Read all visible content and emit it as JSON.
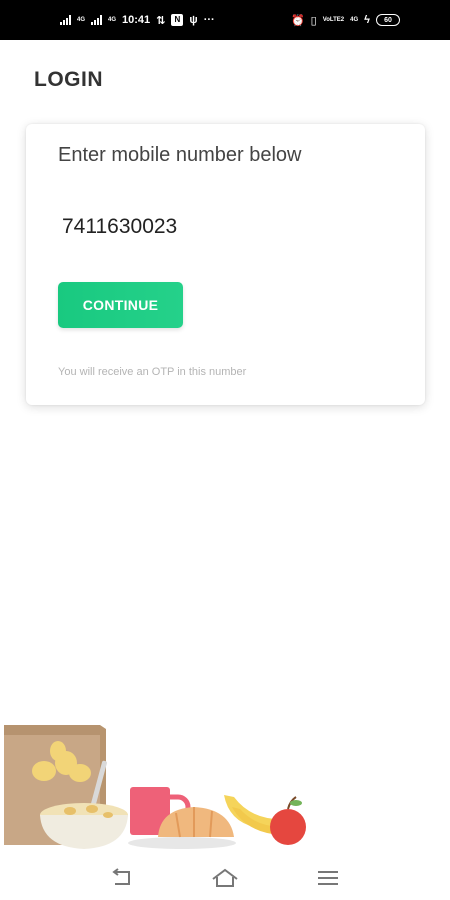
{
  "status_bar": {
    "time": "10:41",
    "signal_label_1": "4G",
    "signal_label_2": "4G",
    "notification_badge": "N",
    "more": "···",
    "network_label": "VoLTE2",
    "lte_label": "4G",
    "battery": "60"
  },
  "header": {
    "title": "LOGIN"
  },
  "login_card": {
    "heading": "Enter mobile number below",
    "mobile_number": "7411630023",
    "continue_label": "CONTINUE",
    "otp_hint": "You will receive an OTP in this number"
  },
  "colors": {
    "accent": "#1ecc84",
    "title": "#333333",
    "hint": "#b4b4b4"
  },
  "icons": {
    "nav": [
      "back-icon",
      "home-icon",
      "menu-icon"
    ],
    "status": [
      "alarm-icon",
      "vibrate-icon",
      "wifi-icon",
      "battery-icon"
    ]
  }
}
